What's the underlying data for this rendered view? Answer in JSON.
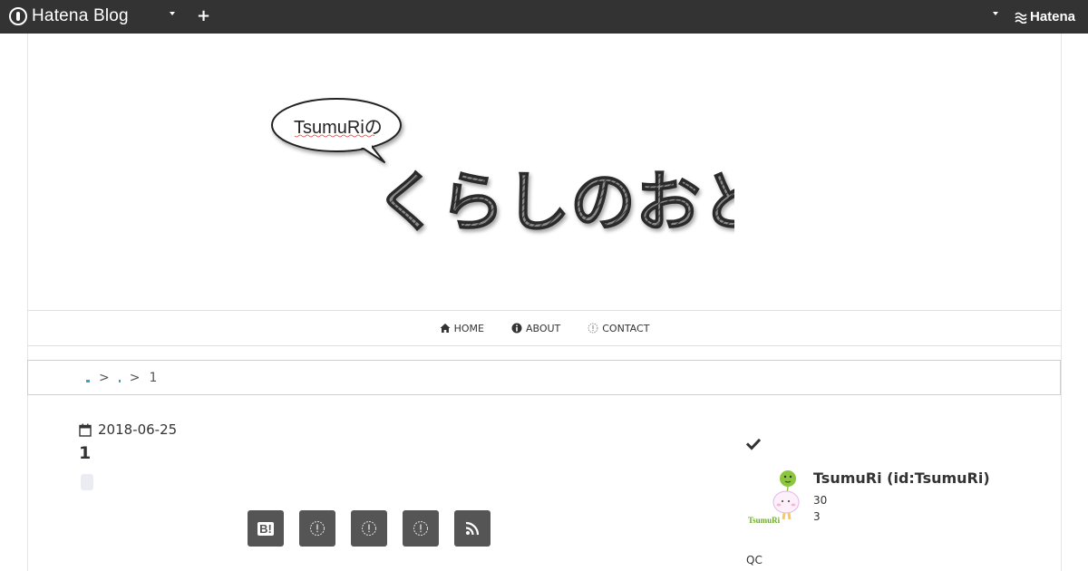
{
  "topbar": {
    "logo_text": "Hatena Blog",
    "brand_right": "Hatena",
    "plus_symbol": "+"
  },
  "header": {
    "bubble_text": "TsumuRiの",
    "title_text": "くらしのおと。"
  },
  "nav": {
    "items": [
      {
        "label": "HOME",
        "icon": "home-icon"
      },
      {
        "label": "ABOUT",
        "icon": "info-icon"
      },
      {
        "label": "CONTACT",
        "icon": "contact-icon"
      }
    ]
  },
  "breadcrumb": {
    "separator": ">",
    "current": "1"
  },
  "entry": {
    "date": "2018-06-25",
    "title": "1"
  },
  "share": {
    "hatebu_label": "B!",
    "buttons": [
      "hatena-bookmark-icon",
      "share-icon",
      "share-icon",
      "share-icon",
      "rss-icon"
    ]
  },
  "sidebar": {
    "profile_name": "TsumuRi (id:TsumuRi)",
    "stat_1": "30",
    "stat_2": "3",
    "section_label": "QC",
    "avatar_label": "TsumuRi"
  },
  "colors": {
    "topbar": "#333333",
    "share_button": "#555555",
    "link_accent": "#3aa3c4"
  }
}
